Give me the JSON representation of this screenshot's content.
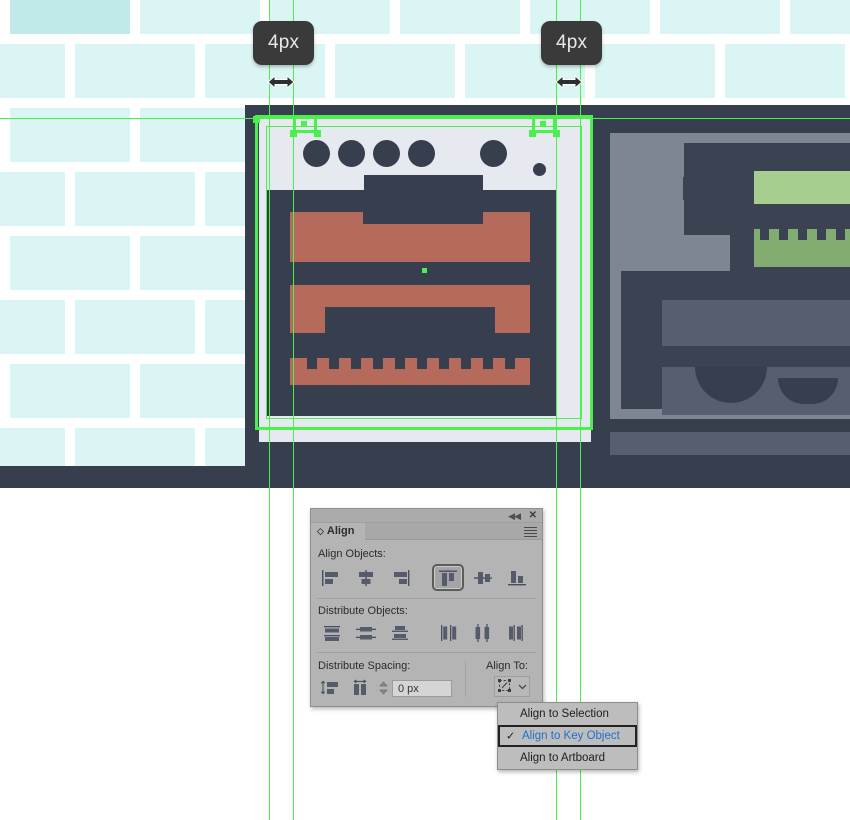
{
  "app": {
    "context": "Adobe Illustrator artboard with smart guides"
  },
  "measurements": [
    {
      "id": "badge-left",
      "label": "4px",
      "icon": "horizontal-resize-arrow-icon"
    },
    {
      "id": "badge-right",
      "label": "4px",
      "icon": "horizontal-resize-arrow-icon"
    }
  ],
  "artwork": {
    "name": "kitchen-oven-illustration",
    "wall_tile_color": "#dbf5f5",
    "wall_tile_accent_color": "#c2e9e9",
    "grout_color": "#ffffff",
    "dark_color": "#373e4e",
    "terracotta_color": "#b56a5c",
    "cabinet_gray": "#7e8694",
    "green_light": "#a6cf8f",
    "green_dark": "#83ad70",
    "selection_color": "#4cf04c",
    "oven_knob_count": 5,
    "oven_face_color": "#e6e9f0"
  },
  "align_panel": {
    "title": "Align",
    "tab_icon": "diamond-icon",
    "collapse_icon": "collapse-double-arrow-icon",
    "close_icon": "close-icon",
    "menu_icon": "panel-menu-icon",
    "sections": {
      "align_objects": {
        "label": "Align Objects:",
        "buttons": [
          {
            "name": "horizontal-align-left",
            "selected": false
          },
          {
            "name": "horizontal-align-center",
            "selected": false
          },
          {
            "name": "horizontal-align-right",
            "selected": false
          },
          {
            "name": "vertical-align-top",
            "selected": true
          },
          {
            "name": "vertical-align-center",
            "selected": false
          },
          {
            "name": "vertical-align-bottom",
            "selected": false
          }
        ]
      },
      "distribute_objects": {
        "label": "Distribute Objects:",
        "buttons": [
          {
            "name": "vertical-distribute-top",
            "selected": false
          },
          {
            "name": "vertical-distribute-center",
            "selected": false
          },
          {
            "name": "vertical-distribute-bottom",
            "selected": false
          },
          {
            "name": "horizontal-distribute-left",
            "selected": false
          },
          {
            "name": "horizontal-distribute-center",
            "selected": false
          },
          {
            "name": "horizontal-distribute-right",
            "selected": false
          }
        ]
      },
      "distribute_spacing": {
        "label": "Distribute Spacing:",
        "buttons": [
          {
            "name": "vertical-distribute-spacing",
            "selected": false
          },
          {
            "name": "horizontal-distribute-spacing",
            "selected": false
          }
        ],
        "spacing_value": "0 px",
        "spacing_placeholder": "0 px",
        "stepper_icon": "up-down-stepper-icon"
      },
      "align_to": {
        "label": "Align To:",
        "button_icon": "align-to-key-object-icon",
        "chevron_icon": "chevron-down-icon"
      }
    }
  },
  "align_menu": {
    "items": [
      {
        "label": "Align to Selection",
        "checked": false,
        "highlighted": false
      },
      {
        "label": "Align to Key Object",
        "checked": true,
        "highlighted": true
      },
      {
        "label": "Align to Artboard",
        "checked": false,
        "highlighted": false
      }
    ],
    "check_glyph": "✓",
    "highlight_color": "#1f6fd0"
  }
}
